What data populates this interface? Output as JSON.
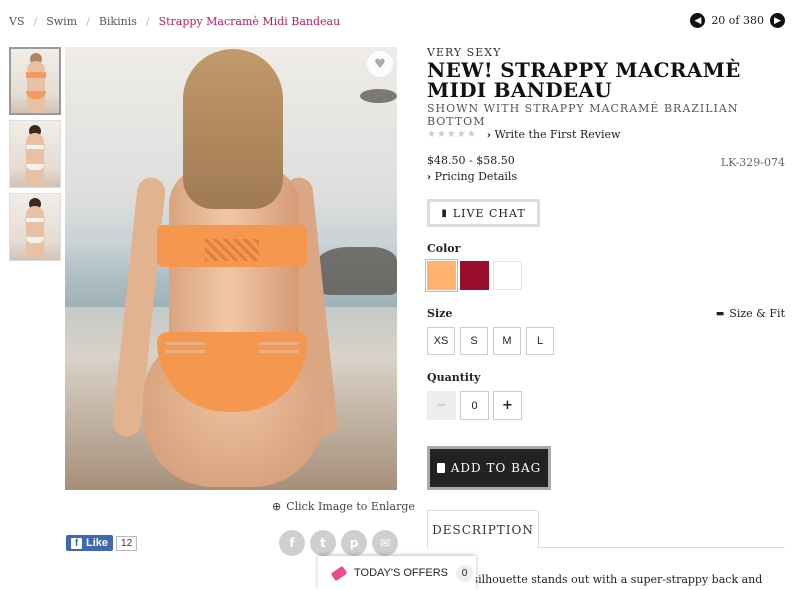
{
  "breadcrumb": {
    "items": [
      "VS",
      "Swim",
      "Bikinis"
    ],
    "current": "Strappy Macramè Midi Bandeau"
  },
  "pager": {
    "text": "20 of 380"
  },
  "thumbnails": [
    "thumb-1",
    "thumb-2",
    "thumb-3"
  ],
  "gallery": {
    "enlarge_text": "Click Image to Enlarge"
  },
  "social": {
    "like_label": "Like",
    "like_count": "12"
  },
  "product": {
    "brand": "VERY SEXY",
    "title": "NEW! STRAPPY MACRAMÈ MIDI BANDEAU",
    "subtitle": "SHOWN WITH STRAPPY MACRAMÉ BRAZILIAN BOTTOM",
    "review_link": "Write the First Review",
    "price": "$48.50 - $58.50",
    "sku": "LK-329-074",
    "pricing_details": "Pricing Details",
    "live_chat": "LIVE CHAT",
    "color_label": "Color",
    "colors": [
      "#ffb36e",
      "#9b0f2e",
      "pattern"
    ],
    "size_label": "Size",
    "size_fit": "Size & Fit",
    "sizes": [
      "XS",
      "S",
      "M",
      "L"
    ],
    "quantity_label": "Quantity",
    "quantity": "0",
    "add_to_bag": "ADD TO BAG",
    "tab_description": "DESCRIPTION",
    "description_snippet": "chic silhouette stands out with a super-strappy back and"
  },
  "offers": {
    "label": "TODAY'S OFFERS",
    "count": "0"
  },
  "colors": {
    "accent": "#c2185b",
    "button": "#222222"
  }
}
